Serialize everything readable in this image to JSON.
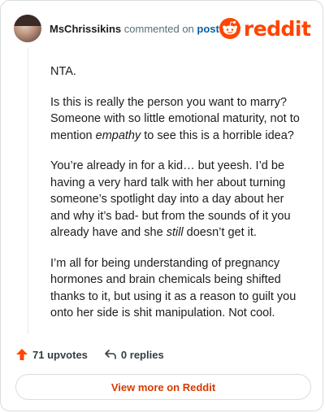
{
  "comment": {
    "author": "MsChrissikins",
    "action_text": "commented on",
    "post_link": "post",
    "paragraphs": [
      [
        "NTA."
      ],
      [
        "Is this is really the person you want to marry? Someone with so little emotional maturity, not to mention ",
        "empathy",
        " to see this is a horrible idea?"
      ],
      [
        "You’re already in for a kid… but yeesh. I’d be having a very hard talk with her about turning someone’s spotlight day into a day about her and why it’s bad- but from the sounds of it you already have and she ",
        "still",
        " doesn’t get it."
      ],
      [
        "I’m all for being understanding of pregnancy hormones and brain chemicals being shifted thanks to it, but using it as a reason to guilt you onto her side is shit manipulation. Not cool."
      ]
    ],
    "upvotes_label": "71 upvotes",
    "replies_label": "0 replies"
  },
  "brand": {
    "wordmark": "reddit",
    "color": "#ff4500"
  },
  "footer": {
    "view_more_label": "View more on Reddit"
  },
  "icons": {
    "logo": "reddit-snoo-icon",
    "upvote": "upvote-arrow-icon",
    "reply": "reply-arrow-icon"
  }
}
